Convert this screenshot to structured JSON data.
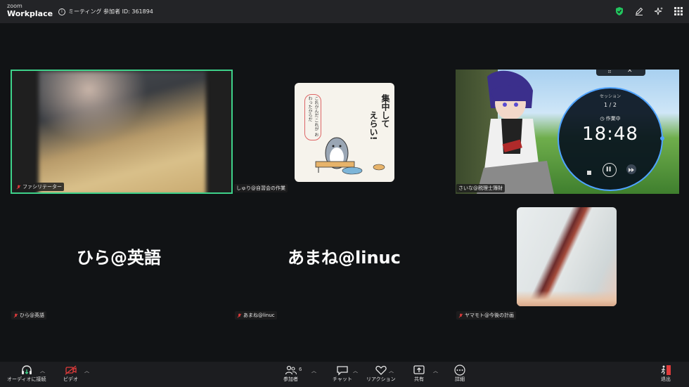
{
  "header": {
    "logo_line1": "zoom",
    "logo_line2": "Workplace",
    "meeting_info": "ミーティング 参加者 ID: 361894"
  },
  "tiles": [
    {
      "label": "ファシリテーター"
    },
    {
      "label": "しゅり@自習会の作業"
    },
    {
      "label": "さいな@税理士簿財"
    },
    {
      "label": "ひら@英語",
      "display_name": "ひら@英語"
    },
    {
      "label": "あまね@linuc",
      "display_name": "あまね@linuc"
    },
    {
      "label": "ヤマモト@今後の計画"
    }
  ],
  "sticker": {
    "text1": "集中して",
    "text2": "えらい!",
    "side_text": "これかんだ これが おわったからだ"
  },
  "timer": {
    "session_label": "セッション",
    "session_count": "1 / 2",
    "state": "作業中",
    "time": "18:48"
  },
  "toolbar": {
    "audio_label": "オーディオに接続",
    "video_label": "ビデオ",
    "participants_label": "参加者",
    "participants_count": "6",
    "chat_label": "チャット",
    "reactions_label": "リアクション",
    "share_label": "共有",
    "more_label": "詳細",
    "leave_label": "退出"
  },
  "colors": {
    "active_border": "#3ed28a",
    "leave_red": "#e03b3b",
    "shield_green": "#22c55e"
  }
}
